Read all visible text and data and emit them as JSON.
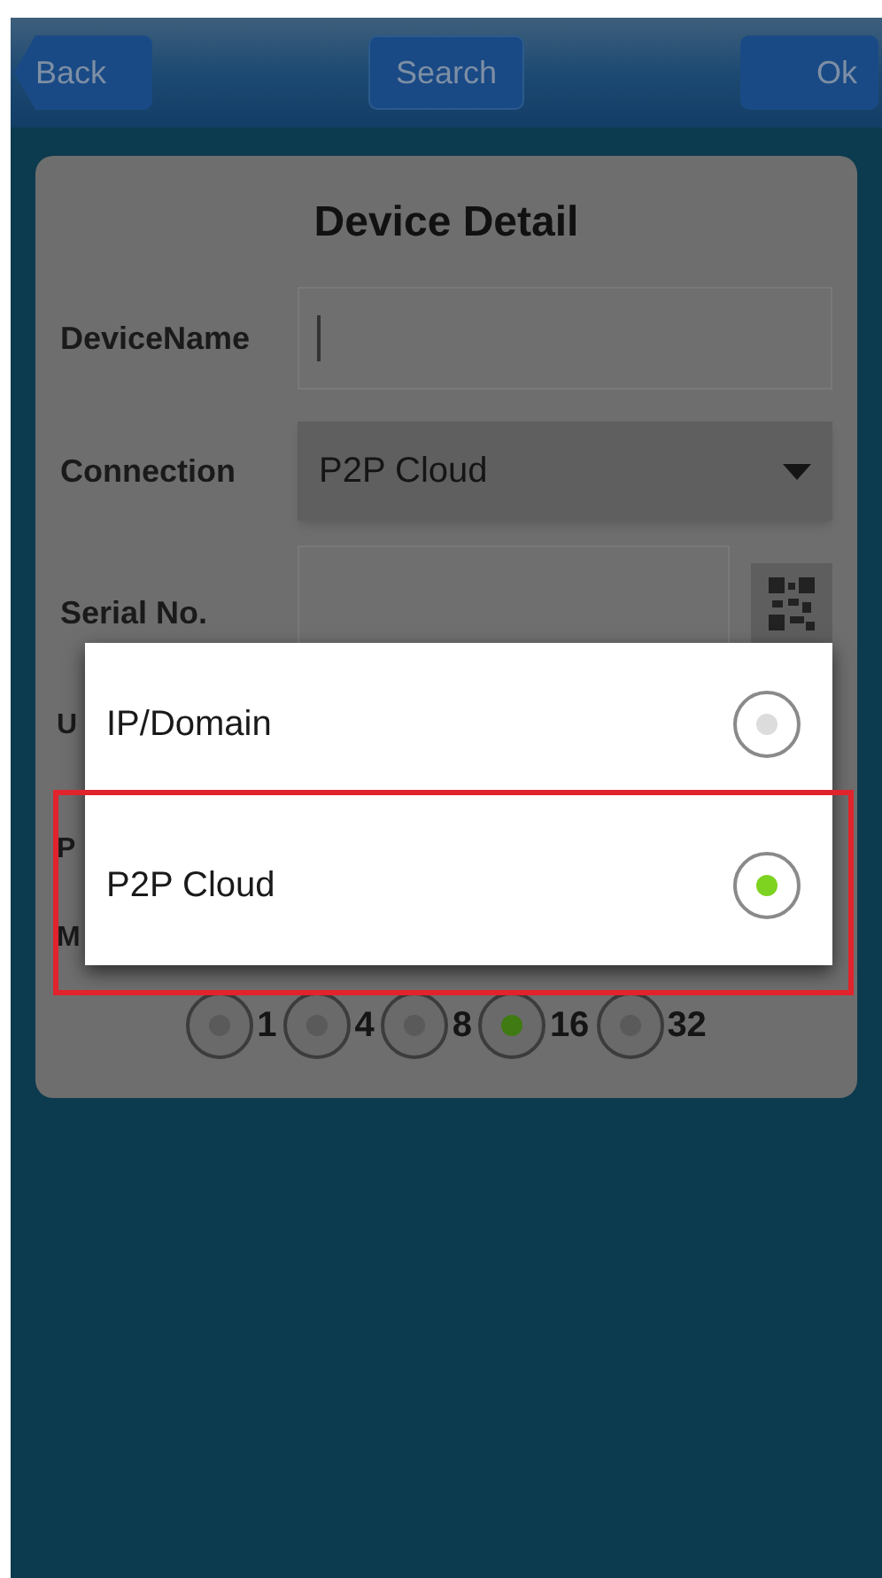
{
  "header": {
    "back": "Back",
    "search": "Search",
    "ok": "Ok"
  },
  "card": {
    "title": "Device Detail",
    "device_name": {
      "label": "DeviceName"
    },
    "connection": {
      "label": "Connection",
      "value": "P2P Cloud"
    },
    "serial": {
      "label": "Serial No."
    },
    "hidden_labels": [
      "U",
      "P",
      "M"
    ],
    "channels": [
      {
        "label": "1",
        "selected": false
      },
      {
        "label": "4",
        "selected": false
      },
      {
        "label": "8",
        "selected": false
      },
      {
        "label": "16",
        "selected": true
      },
      {
        "label": "32",
        "selected": false
      }
    ]
  },
  "dialog": {
    "options": [
      {
        "label": "IP/Domain",
        "selected": false
      },
      {
        "label": "P2P Cloud",
        "selected": true
      }
    ]
  }
}
